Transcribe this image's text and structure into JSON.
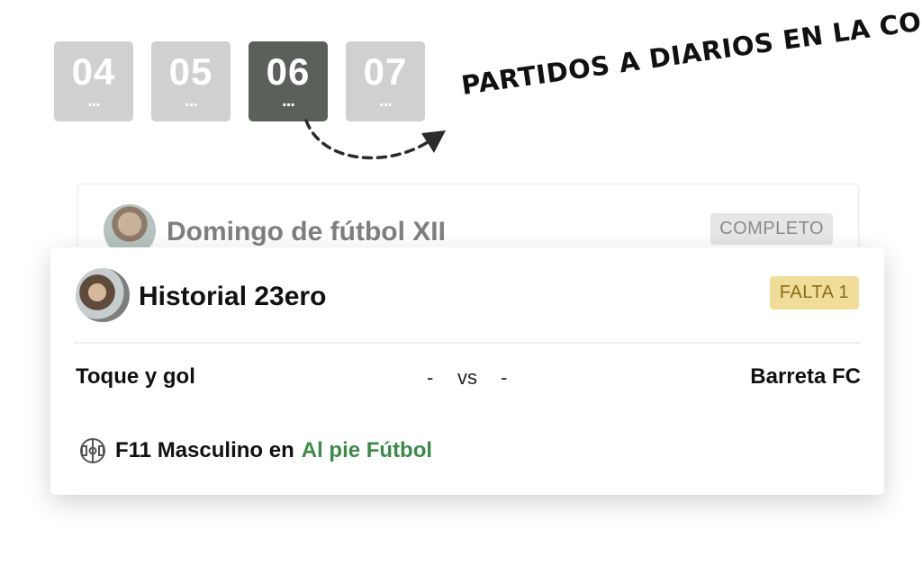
{
  "days": [
    {
      "number": "04",
      "dots": "...",
      "active": false
    },
    {
      "number": "05",
      "dots": "...",
      "active": false
    },
    {
      "number": "06",
      "dots": "...",
      "active": true
    },
    {
      "number": "07",
      "dots": "...",
      "active": false
    }
  ],
  "promo": {
    "text": "PARTIDOS A DIARIOS EN LA COMUNIDAD"
  },
  "background_match": {
    "title": "Domingo de fútbol XII",
    "status_badge": "COMPLETO"
  },
  "match": {
    "title": "Historial 23ero",
    "status_badge": "FALTA 1",
    "home_team": "Toque y gol",
    "home_score": "-",
    "vs_label": "vs",
    "away_score": "-",
    "away_team": "Barreta FC",
    "format_text": "F11 Masculino en",
    "venue": "Al pie Fútbol",
    "field_icon": "soccer-field-icon"
  },
  "colors": {
    "tile_inactive": "#cfd0cf",
    "tile_active": "#5b605b",
    "badge_missing_bg": "#f1dd9a",
    "badge_missing_text": "#8a6d17",
    "venue_link": "#3c8a47",
    "badge_complete_bg": "#e6e6e6"
  }
}
